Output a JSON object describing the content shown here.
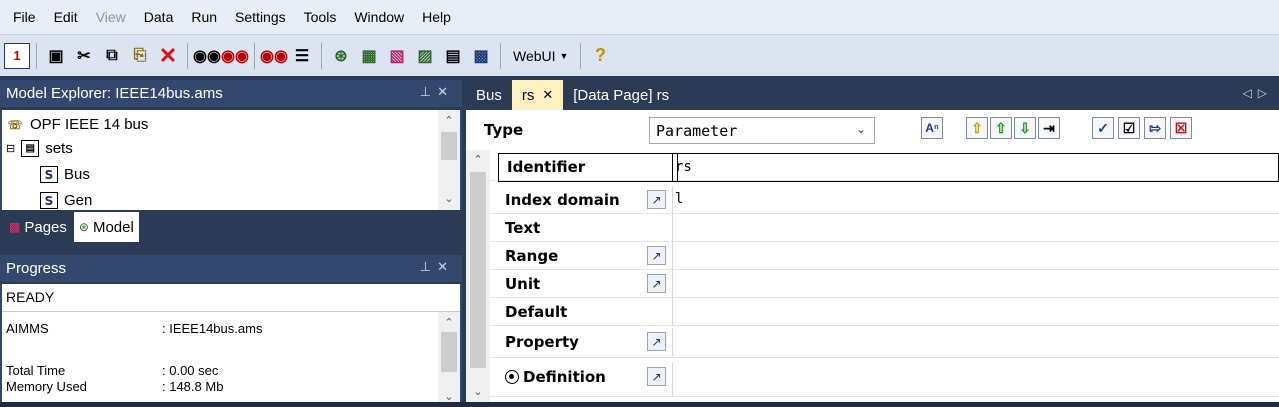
{
  "menubar": {
    "items": [
      {
        "label": "File",
        "disabled": false
      },
      {
        "label": "Edit",
        "disabled": false
      },
      {
        "label": "View",
        "disabled": true
      },
      {
        "label": "Data",
        "disabled": false
      },
      {
        "label": "Run",
        "disabled": false
      },
      {
        "label": "Settings",
        "disabled": false
      },
      {
        "label": "Tools",
        "disabled": false
      },
      {
        "label": "Window",
        "disabled": false
      },
      {
        "label": "Help",
        "disabled": false
      }
    ]
  },
  "toolbar": {
    "webui_label": "WebUI"
  },
  "model_explorer": {
    "title": "Model Explorer: IEEE14bus.ams",
    "tree": {
      "root": "OPF IEEE 14 bus",
      "sets_label": "sets",
      "bus_label": "Bus",
      "gen_label": "Gen"
    },
    "tabs": {
      "pages": "Pages",
      "model": "Model"
    }
  },
  "progress": {
    "title": "Progress",
    "status": "READY",
    "rows": [
      {
        "key": "AIMMS",
        "value": ": IEEE14bus.ams"
      },
      {
        "key": "Total Time",
        "value": ": 0.00 sec"
      },
      {
        "key": "Memory Used",
        "value": ": 148.8 Mb"
      }
    ]
  },
  "doc_tabs": {
    "bus": "Bus",
    "rs": "rs",
    "data_page": "[Data Page] rs"
  },
  "attribute_form": {
    "type_label": "Type",
    "type_value": "Parameter",
    "rows": {
      "identifier": {
        "label": "Identifier",
        "value": "rs"
      },
      "index_domain": {
        "label": "Index domain",
        "value": "l"
      },
      "text": {
        "label": "Text",
        "value": ""
      },
      "range": {
        "label": "Range",
        "value": ""
      },
      "unit": {
        "label": "Unit",
        "value": ""
      },
      "default": {
        "label": "Default",
        "value": ""
      },
      "property": {
        "label": "Property",
        "value": ""
      },
      "definition": {
        "label": "Definition",
        "value": ""
      }
    }
  },
  "colors": {
    "panel_title_bg": "#34486e",
    "app_bg": "#2b3a55",
    "active_doc_tab": "#fff0c2",
    "menubar_bg": "#e8edf6"
  }
}
